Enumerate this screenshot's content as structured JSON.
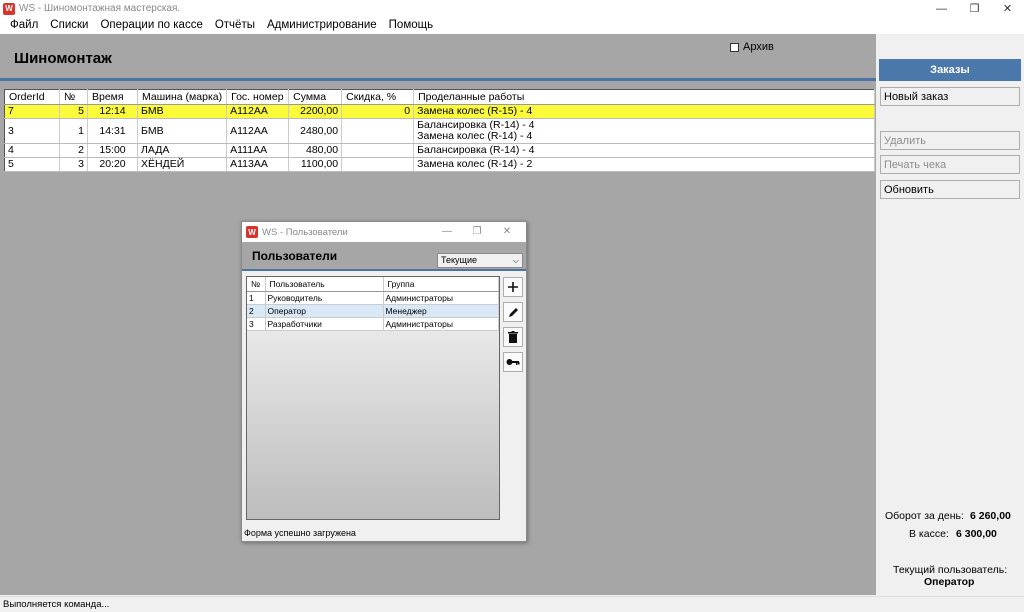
{
  "window": {
    "title": "WS - Шиномонтажная мастерская.",
    "icon_letter": "W",
    "controls": [
      "—",
      "❐",
      "✕"
    ]
  },
  "menu": [
    "Файл",
    "Списки",
    "Операции по кассе",
    "Отчёты",
    "Администрирование",
    "Помощь"
  ],
  "page": {
    "title": "Шиномонтаж",
    "archive_label": "Архив",
    "archive_checked": false
  },
  "orders_table": {
    "columns": [
      "OrderId",
      "№",
      "Время",
      "Машина (марка)",
      "Гос. номер",
      "Сумма",
      "Скидка, %",
      "Проделанные работы"
    ],
    "rows": [
      {
        "order_id": "7",
        "num": "5",
        "time": "12:14",
        "car": "БМВ",
        "plate": "А112АА",
        "sum": "2200,00",
        "discount": "0",
        "works": [
          "Замена колес (R-15) - 4"
        ],
        "selected": true
      },
      {
        "order_id": "3",
        "num": "1",
        "time": "14:31",
        "car": "БМВ",
        "plate": "А112АА",
        "sum": "2480,00",
        "discount": "",
        "works": [
          "Балансировка (R-14) - 4",
          "Замена колес (R-14) - 4"
        ],
        "selected": false
      },
      {
        "order_id": "4",
        "num": "2",
        "time": "15:00",
        "car": "ЛАДА",
        "plate": "А111АА",
        "sum": "480,00",
        "discount": "",
        "works": [
          "Балансировка (R-14) - 4"
        ],
        "selected": false
      },
      {
        "order_id": "5",
        "num": "3",
        "time": "20:20",
        "car": "ХЁНДЕЙ",
        "plate": "А113АА",
        "sum": "1100,00",
        "discount": "",
        "works": [
          "Замена колес (R-14) - 2"
        ],
        "selected": false
      }
    ]
  },
  "right_panel": {
    "tab": "Заказы",
    "buttons": {
      "new_order": "Новый заказ",
      "delete": "Удалить",
      "print_receipt": "Печать чека",
      "refresh": "Обновить"
    },
    "turnover_label": "Оборот за день:",
    "turnover_value": "6 260,00",
    "cash_label": "В кассе:",
    "cash_value": "6 300,00",
    "current_user_label": "Текущий пользователь:",
    "current_user_value": "Оператор"
  },
  "status_bar": "Выполняется команда...",
  "users_dialog": {
    "title": "WS - Пользователи",
    "heading": "Пользователи",
    "filter_value": "Текущие",
    "columns": [
      "№",
      "Пользователь",
      "Группа"
    ],
    "rows": [
      {
        "num": "1",
        "user": "Руководитель",
        "group": "Администраторы",
        "selected": false
      },
      {
        "num": "2",
        "user": "Оператор",
        "group": "Менеджер",
        "selected": true
      },
      {
        "num": "3",
        "user": "Разработчики",
        "group": "Администраторы",
        "selected": false
      }
    ],
    "tool_icons": [
      "add-icon",
      "edit-pencil-icon",
      "trash-icon",
      "key-icon"
    ],
    "status": "Форма успешно загружена"
  },
  "colors": {
    "selected_row": "#fbfb3b",
    "accent": "#4a78aa",
    "workspace_gray": "#a6a6a6"
  }
}
